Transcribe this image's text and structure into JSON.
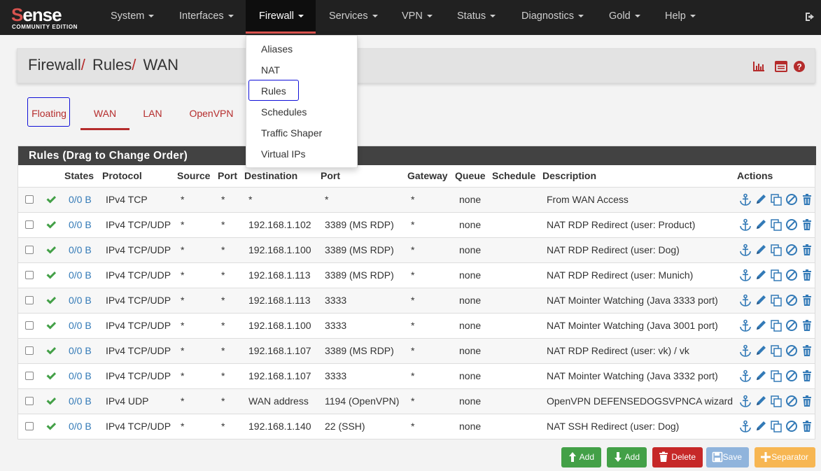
{
  "brand": {
    "logo_text_a": "S",
    "logo_text_b": "ense",
    "edition": "COMMUNITY EDITION"
  },
  "nav": {
    "items": [
      "System",
      "Interfaces",
      "Firewall",
      "Services",
      "VPN",
      "Status",
      "Diagnostics",
      "Gold",
      "Help"
    ],
    "active": "Firewall",
    "logout_icon": "sign-out-icon"
  },
  "firewall_menu": [
    "Aliases",
    "NAT",
    "Rules",
    "Schedules",
    "Traffic Shaper",
    "Virtual IPs"
  ],
  "breadcrumb": {
    "part1": "Firewall",
    "sep": "/",
    "part2": "Rules",
    "part3": "WAN"
  },
  "header_icons": [
    "chart-bar-icon",
    "list-icon",
    "help-icon"
  ],
  "tabs": [
    "Floating",
    "WAN",
    "LAN",
    "OpenVPN"
  ],
  "active_tab": "WAN",
  "panel": {
    "title": "Rules (Drag to Change Order)"
  },
  "columns": [
    "States",
    "Protocol",
    "Source",
    "Port",
    "Destination",
    "Port",
    "Gateway",
    "Queue",
    "Schedule",
    "Description",
    "Actions"
  ],
  "rules": [
    {
      "states": "0/0 B",
      "protocol": "IPv4 TCP",
      "source": "*",
      "sport": "*",
      "destination": "*",
      "dport": "*",
      "gateway": "*",
      "queue": "none",
      "schedule": "",
      "description": "From WAN Access"
    },
    {
      "states": "0/0 B",
      "protocol": "IPv4 TCP/UDP",
      "source": "*",
      "sport": "*",
      "destination": "192.168.1.102",
      "dport": "3389 (MS RDP)",
      "gateway": "*",
      "queue": "none",
      "schedule": "",
      "description": "NAT RDP Redirect (user: Product)"
    },
    {
      "states": "0/0 B",
      "protocol": "IPv4 TCP/UDP",
      "source": "*",
      "sport": "*",
      "destination": "192.168.1.100",
      "dport": "3389 (MS RDP)",
      "gateway": "*",
      "queue": "none",
      "schedule": "",
      "description": "NAT RDP Redirect (user: Dog)"
    },
    {
      "states": "0/0 B",
      "protocol": "IPv4 TCP/UDP",
      "source": "*",
      "sport": "*",
      "destination": "192.168.1.113",
      "dport": "3389 (MS RDP)",
      "gateway": "*",
      "queue": "none",
      "schedule": "",
      "description": "NAT RDP Redirect (user: Munich)"
    },
    {
      "states": "0/0 B",
      "protocol": "IPv4 TCP/UDP",
      "source": "*",
      "sport": "*",
      "destination": "192.168.1.113",
      "dport": "3333",
      "gateway": "*",
      "queue": "none",
      "schedule": "",
      "description": "NAT Mointer Watching (Java 3333 port)"
    },
    {
      "states": "0/0 B",
      "protocol": "IPv4 TCP/UDP",
      "source": "*",
      "sport": "*",
      "destination": "192.168.1.100",
      "dport": "3333",
      "gateway": "*",
      "queue": "none",
      "schedule": "",
      "description": "NAT Mointer Watching (Java 3001 port)"
    },
    {
      "states": "0/0 B",
      "protocol": "IPv4 TCP/UDP",
      "source": "*",
      "sport": "*",
      "destination": "192.168.1.107",
      "dport": "3389 (MS RDP)",
      "gateway": "*",
      "queue": "none",
      "schedule": "",
      "description": "NAT RDP Redirect (user: vk) / vk"
    },
    {
      "states": "0/0 B",
      "protocol": "IPv4 TCP/UDP",
      "source": "*",
      "sport": "*",
      "destination": "192.168.1.107",
      "dport": "3333",
      "gateway": "*",
      "queue": "none",
      "schedule": "",
      "description": "NAT Mointer Watching (Java 3332 port)"
    },
    {
      "states": "0/0 B",
      "protocol": "IPv4 UDP",
      "source": "*",
      "sport": "*",
      "destination": "WAN address",
      "dport": "1194 (OpenVPN)",
      "gateway": "*",
      "queue": "none",
      "schedule": "",
      "description": "OpenVPN DEFENSEDOGSVPNCA wizard"
    },
    {
      "states": "0/0 B",
      "protocol": "IPv4 TCP/UDP",
      "source": "*",
      "sport": "*",
      "destination": "192.168.1.140",
      "dport": "22 (SSH)",
      "gateway": "*",
      "queue": "none",
      "schedule": "",
      "description": "NAT SSH Redirect (user: Dog)"
    }
  ],
  "row_action_icons": [
    "anchor-icon",
    "pencil-icon",
    "copy-icon",
    "ban-icon",
    "trash-icon"
  ],
  "buttons": [
    {
      "label": "Add",
      "icon": "arrow-up-icon",
      "color": "#43a047"
    },
    {
      "label": "Add",
      "icon": "arrow-down-icon",
      "color": "#43a047"
    },
    {
      "label": "Delete",
      "icon": "trash-icon",
      "color": "#c62828"
    },
    {
      "label": "Save",
      "icon": "save-icon",
      "color": "#90b4dc"
    },
    {
      "label": "Separator",
      "icon": "plus-icon",
      "color": "#f7b652"
    }
  ],
  "colors": {
    "navbar": "#212121",
    "accent": "#b52c2c",
    "link": "#337ab7",
    "check": "#43a047",
    "highlight": "#1010d8"
  }
}
